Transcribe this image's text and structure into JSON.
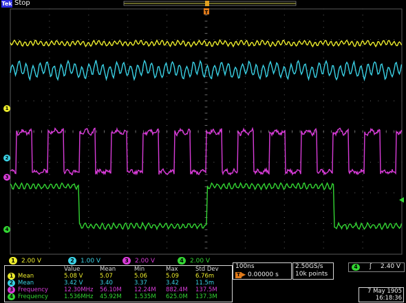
{
  "topbar": {
    "logo": "Tek",
    "state": "Stop"
  },
  "channels": [
    {
      "id": "1",
      "color": "#ecec2c",
      "scale": "2.00 V"
    },
    {
      "id": "2",
      "color": "#3ad2e6",
      "scale": "1.00 V"
    },
    {
      "id": "3",
      "color": "#d93cd9",
      "scale": "2.00 V"
    },
    {
      "id": "4",
      "color": "#33d633",
      "scale": "2.00 V"
    }
  ],
  "measurements": {
    "headers": [
      "Value",
      "Mean",
      "Min",
      "Max",
      "Std Dev"
    ],
    "rows": [
      {
        "ch": "1",
        "color": "#ecec2c",
        "name": "Mean",
        "values": [
          "5.08 V",
          "5.07",
          "5.06",
          "5.09",
          "6.76m"
        ]
      },
      {
        "ch": "2",
        "color": "#3ad2e6",
        "name": "Mean",
        "values": [
          "3.42 V",
          "3.40",
          "3.37",
          "3.42",
          "11.5m"
        ]
      },
      {
        "ch": "3",
        "color": "#d93cd9",
        "name": "Frequency",
        "values": [
          "12.30MHz",
          "56.10M",
          "12.24M",
          "882.4M",
          "137.5M"
        ]
      },
      {
        "ch": "4",
        "color": "#33d633",
        "name": "Frequency",
        "values": [
          "1.536MHz",
          "45.92M",
          "1.535M",
          "625.0M",
          "137.3M"
        ]
      }
    ]
  },
  "timebase": {
    "scale": "100ns",
    "position": "0.00000 s"
  },
  "acquisition": {
    "rate": "2.50GS/s",
    "points": "10k points"
  },
  "trigger": {
    "source": "4",
    "slope": "ʃ",
    "level": "2.40 V"
  },
  "datetime": {
    "date": "7 May 1905",
    "time": "16:18:36"
  }
}
